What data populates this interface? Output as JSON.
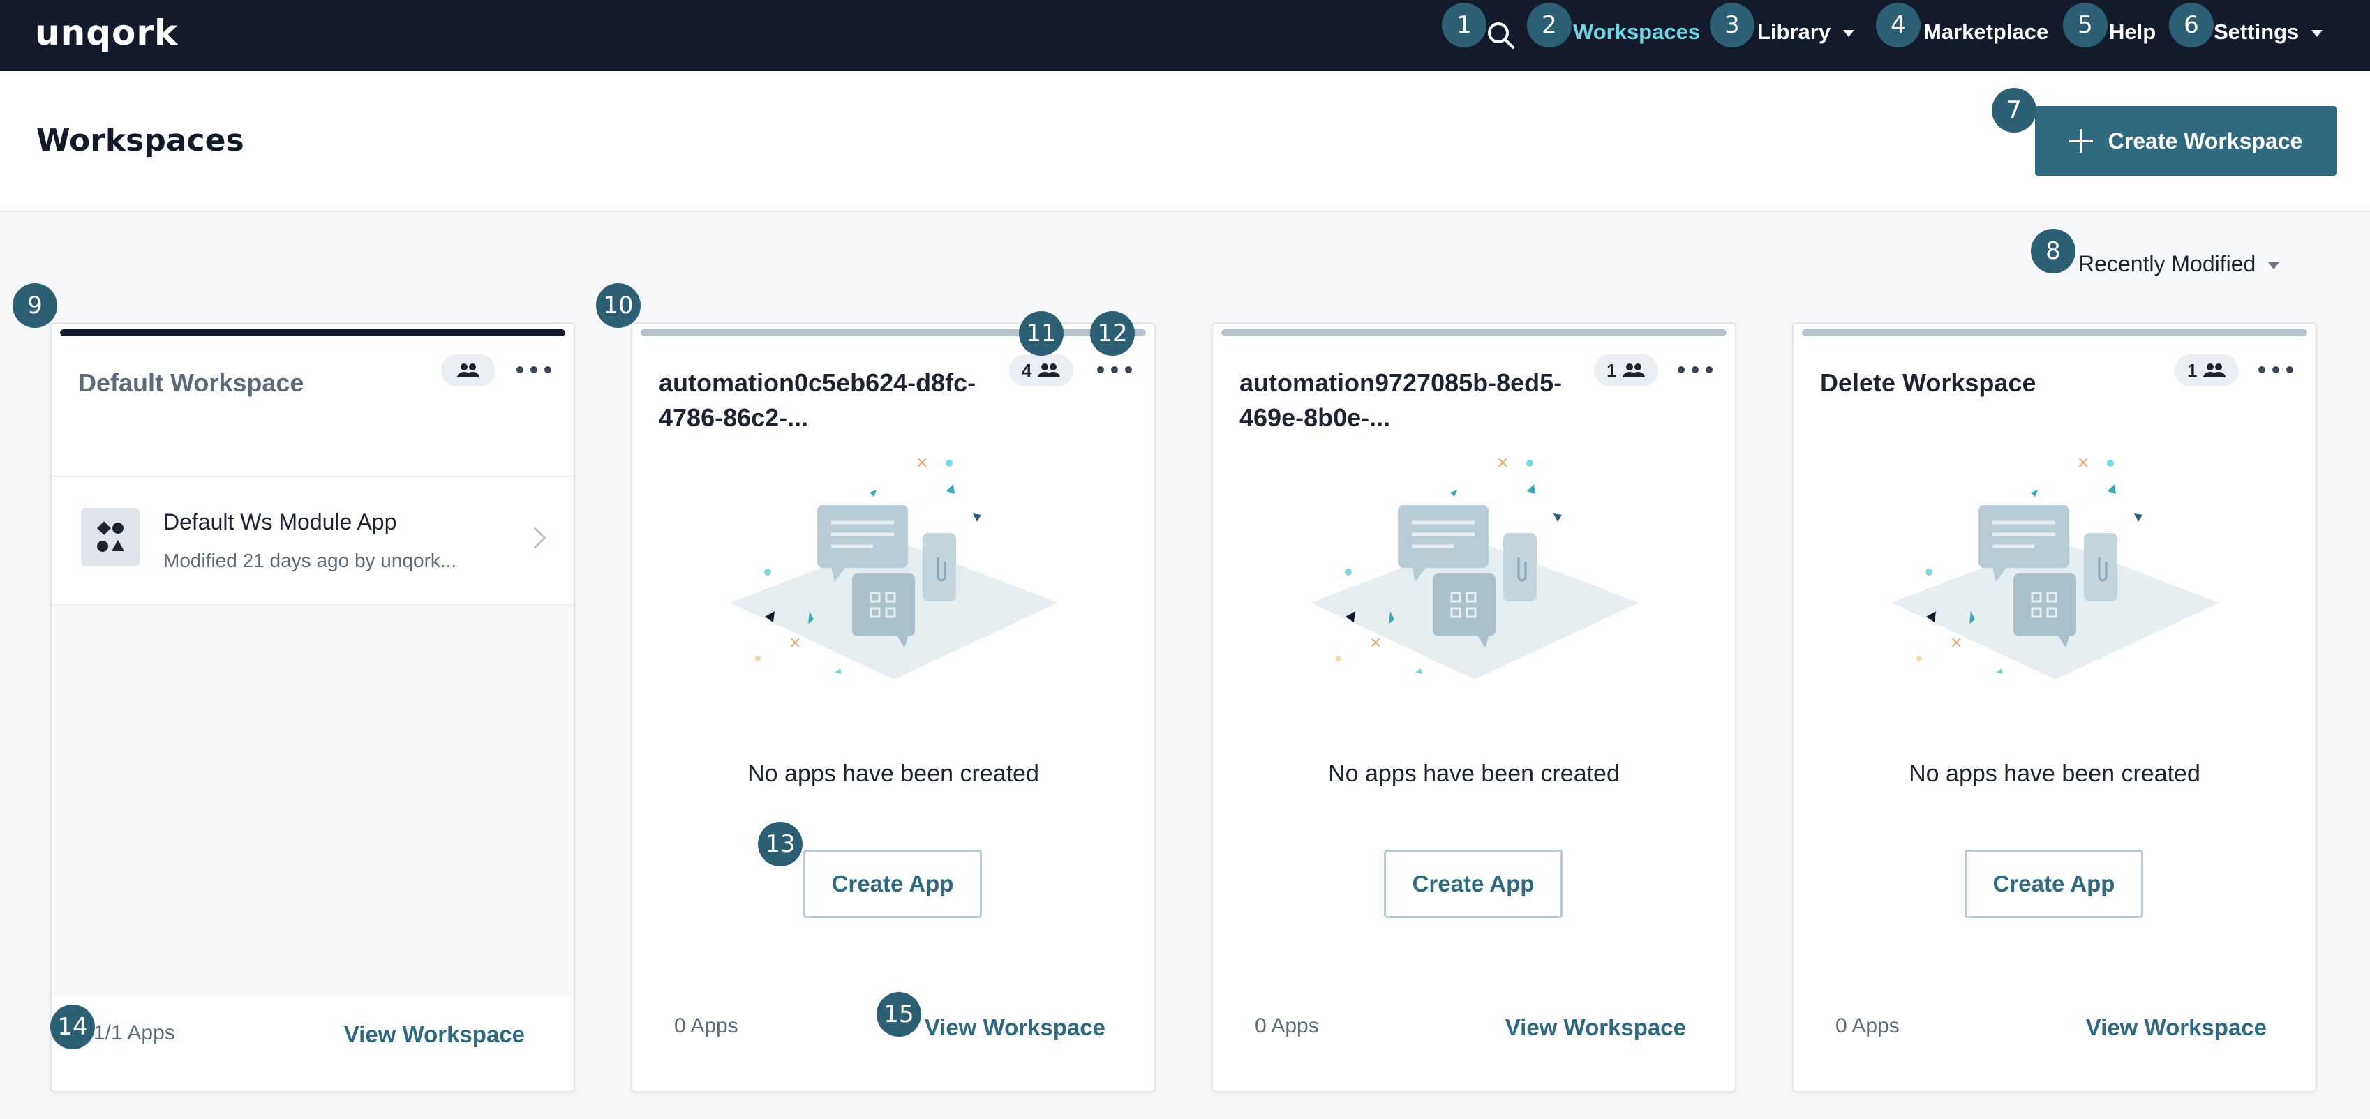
{
  "brand": {
    "logo": "unqork"
  },
  "nav": {
    "items": [
      {
        "label": "Workspaces",
        "active": true
      },
      {
        "label": "Library",
        "dropdown": true
      },
      {
        "label": "Marketplace"
      },
      {
        "label": "Help"
      },
      {
        "label": "Settings",
        "dropdown": true
      }
    ]
  },
  "header": {
    "title": "Workspaces",
    "create_label": "Create Workspace"
  },
  "sort": {
    "label": "Recently Modified"
  },
  "cards": [
    {
      "title": "Default Workspace",
      "members": "",
      "app": {
        "name": "Default Ws Module App",
        "meta": "Modified 21 days ago by unqork..."
      },
      "apps_count": "1/1 Apps",
      "view_label": "View Workspace"
    },
    {
      "title": "automation0c5eb624-d8fc-4786-86c2-...",
      "members": "4",
      "empty_text": "No apps have been created",
      "create_app_label": "Create App",
      "apps_count": "0 Apps",
      "view_label": "View Workspace"
    },
    {
      "title": "automation9727085b-8ed5-469e-8b0e-...",
      "members": "1",
      "empty_text": "No apps have been created",
      "create_app_label": "Create App",
      "apps_count": "0 Apps",
      "view_label": "View Workspace"
    },
    {
      "title": "Delete Workspace",
      "members": "1",
      "empty_text": "No apps have been created",
      "create_app_label": "Create App",
      "apps_count": "0 Apps",
      "view_label": "View Workspace"
    }
  ],
  "markers": [
    "1",
    "2",
    "3",
    "4",
    "5",
    "6",
    "7",
    "8",
    "9",
    "10",
    "11",
    "12",
    "13",
    "14",
    "15"
  ],
  "colors": {
    "nav_bg": "#131b2b",
    "accent": "#2f6a80",
    "active_nav": "#6fd3e3",
    "marker": "#2d5f74"
  }
}
